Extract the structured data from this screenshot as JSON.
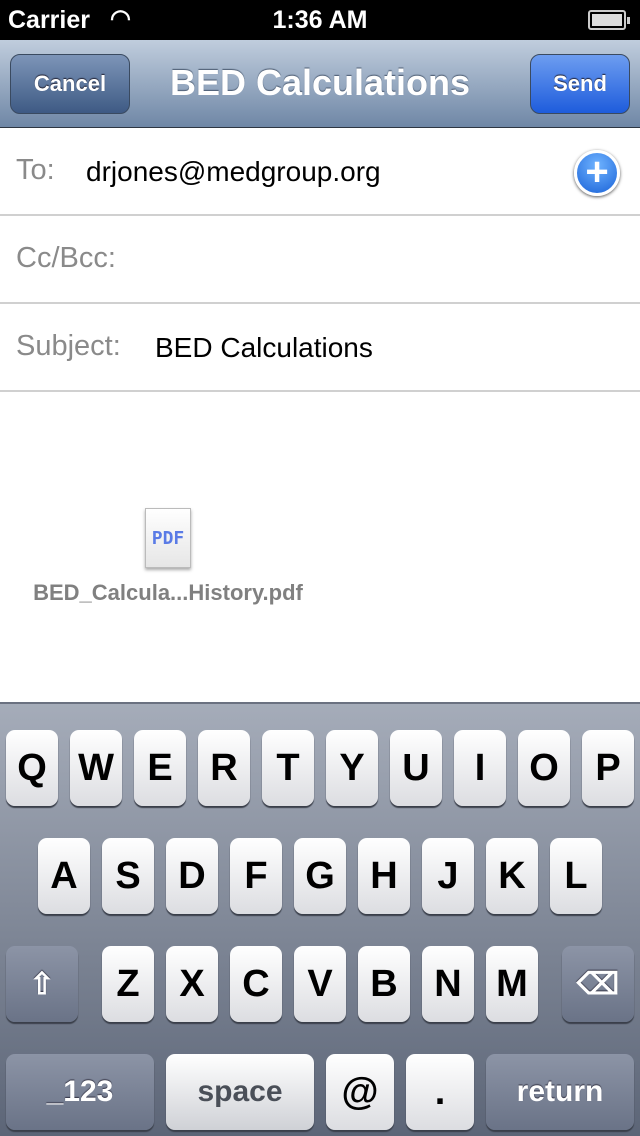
{
  "status": {
    "carrier": "Carrier",
    "time": "1:36 AM"
  },
  "nav": {
    "title": "BED Calculations",
    "cancel": "Cancel",
    "send": "Send"
  },
  "fields": {
    "to_label": "To:",
    "to_value": "drjones@medgroup.org",
    "cc_label": "Cc/Bcc:",
    "subject_label": "Subject:",
    "subject_value": "BED Calculations"
  },
  "attachment": {
    "icon_text": "PDF",
    "filename": "BED_Calcula...History.pdf"
  },
  "keyboard": {
    "row1": [
      "Q",
      "W",
      "E",
      "R",
      "T",
      "Y",
      "U",
      "I",
      "O",
      "P"
    ],
    "row2": [
      "A",
      "S",
      "D",
      "F",
      "G",
      "H",
      "J",
      "K",
      "L"
    ],
    "row3": [
      "Z",
      "X",
      "C",
      "V",
      "B",
      "N",
      "M"
    ],
    "numbers": "_123",
    "space": "space",
    "at": "@",
    "dot": ".",
    "return": "return"
  }
}
